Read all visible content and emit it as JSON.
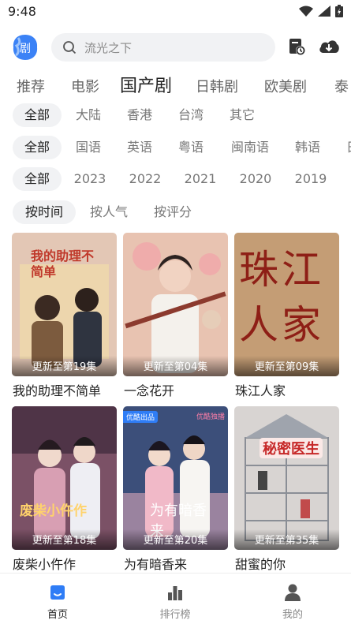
{
  "status": {
    "time": "9:48"
  },
  "search": {
    "placeholder": "流光之下"
  },
  "tabs": [
    "推荐",
    "电影",
    "国产剧",
    "日韩剧",
    "欧美剧",
    "泰"
  ],
  "active_tab": "国产剧",
  "filters": {
    "region": [
      "全部",
      "大陆",
      "香港",
      "台湾",
      "其它"
    ],
    "language": [
      "全部",
      "国语",
      "英语",
      "粤语",
      "闽南语",
      "韩语",
      "日"
    ],
    "year": [
      "全部",
      "2023",
      "2022",
      "2021",
      "2020",
      "2019"
    ],
    "sort": [
      "按时间",
      "按人气",
      "按评分"
    ]
  },
  "shows": [
    {
      "title": "我的助理不简单",
      "episode": "更新至第19集",
      "poster_overlay": "我的助理不简单",
      "poster_color": "#e3c7b5"
    },
    {
      "title": "一念花开",
      "episode": "更新至第04集",
      "poster_overlay": "",
      "poster_color": "#d9a995"
    },
    {
      "title": "珠江人家",
      "episode": "更新至第09集",
      "poster_overlay": "珠江人家",
      "poster_color": "#b88a63"
    },
    {
      "title": "废柴小仵作",
      "episode": "更新至第18集",
      "poster_overlay": "废柴小仵作",
      "poster_color": "#7b5166"
    },
    {
      "title": "为有暗香来",
      "episode": "更新至第20集",
      "poster_overlay": "为有暗香来",
      "poster_color": "#3c4f7a",
      "badge": "优酷出品",
      "corner_text": "优酷独播"
    },
    {
      "title": "甜蜜的你",
      "episode": "更新至第35集",
      "poster_overlay": "秘密医生",
      "poster_color": "#d8d4d2"
    }
  ],
  "bottom_nav": [
    {
      "label": "首页",
      "icon": "home-icon"
    },
    {
      "label": "排行榜",
      "icon": "ranking-icon"
    },
    {
      "label": "我的",
      "icon": "profile-icon"
    }
  ],
  "colors": {
    "accent": "#2f7df6",
    "chip_bg": "#f1f2f4",
    "text": "#222222",
    "muted": "#777777"
  }
}
